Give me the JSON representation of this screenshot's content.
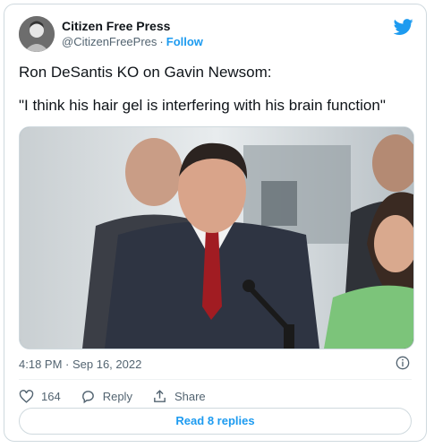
{
  "author": {
    "name": "Citizen Free Press",
    "handle": "@CitizenFreePres",
    "separator": "·",
    "follow_label": "Follow"
  },
  "tweet": {
    "line1": "Ron DeSantis KO on Gavin Newsom:",
    "line2": "\"I think his hair gel is interfering with his brain function\""
  },
  "timestamp": "4:18 PM · Sep 16, 2022",
  "actions": {
    "like_count": "164",
    "reply_label": "Reply",
    "share_label": "Share"
  },
  "read_replies_label": "Read 8 replies",
  "colors": {
    "brand": "#1d9bf0",
    "like": "#f91880",
    "text_secondary": "#536471"
  },
  "icons": [
    "twitter-bird-icon",
    "info-icon",
    "heart-icon",
    "reply-icon",
    "share-icon"
  ]
}
